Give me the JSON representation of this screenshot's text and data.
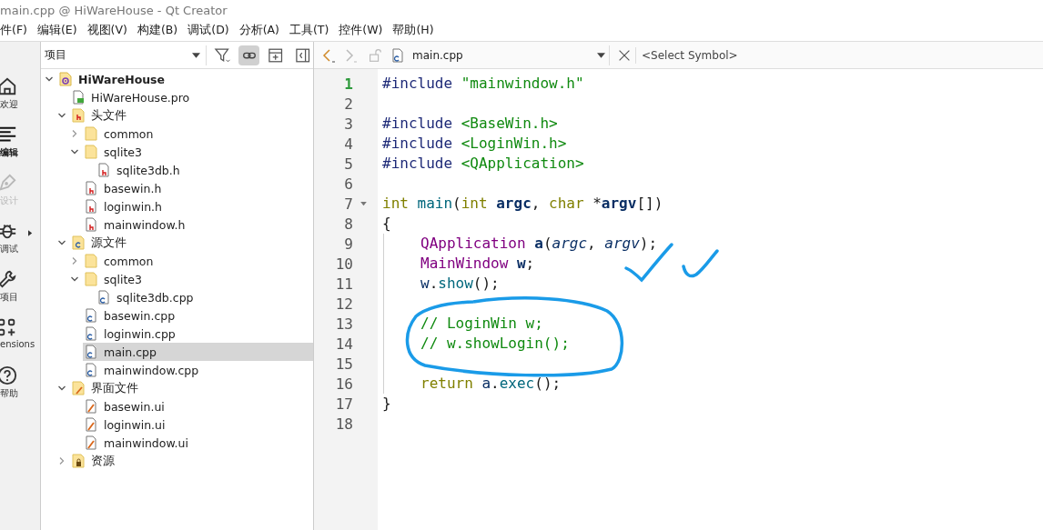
{
  "window": {
    "title": "main.cpp @ HiWareHouse - Qt Creator"
  },
  "menu_bar": [
    "件(F)",
    "编辑(E)",
    "视图(V)",
    "构建(B)",
    "调试(D)",
    "分析(A)",
    "工具(T)",
    "控件(W)",
    "帮助(H)"
  ],
  "mode_bar": [
    {
      "label": "欢迎",
      "kind": "welcome",
      "selected": false,
      "disabled": false
    },
    {
      "label": "编辑",
      "kind": "edit",
      "selected": true,
      "disabled": false
    },
    {
      "label": "设计",
      "kind": "design",
      "selected": false,
      "disabled": true
    },
    {
      "label": "调试",
      "kind": "debug",
      "selected": false,
      "disabled": false
    },
    {
      "label": "项目",
      "kind": "projects",
      "selected": false,
      "disabled": false
    },
    {
      "label": "ensions",
      "kind": "extensions",
      "selected": false,
      "disabled": false
    },
    {
      "label": "帮助",
      "kind": "help",
      "selected": false,
      "disabled": false
    }
  ],
  "project_panel": {
    "view_selector": "项目",
    "sync_with_editor": true,
    "tree": [
      {
        "label": "HiWareHouse",
        "kind": "project",
        "expanded": true,
        "selected": false,
        "children": [
          {
            "label": "HiWareHouse.pro",
            "kind": "pro",
            "selected": false
          },
          {
            "label": "头文件",
            "kind": "folder-h",
            "expanded": true,
            "selected": false,
            "children": [
              {
                "label": "common",
                "kind": "folder",
                "expanded": false,
                "selected": false
              },
              {
                "label": "sqlite3",
                "kind": "folder",
                "expanded": true,
                "selected": false,
                "children": [
                  {
                    "label": "sqlite3db.h",
                    "kind": "h",
                    "selected": false
                  }
                ]
              },
              {
                "label": "basewin.h",
                "kind": "h",
                "selected": false
              },
              {
                "label": "loginwin.h",
                "kind": "h",
                "selected": false
              },
              {
                "label": "mainwindow.h",
                "kind": "h",
                "selected": false
              }
            ]
          },
          {
            "label": "源文件",
            "kind": "folder-cpp",
            "expanded": true,
            "selected": false,
            "children": [
              {
                "label": "common",
                "kind": "folder",
                "expanded": false,
                "selected": false
              },
              {
                "label": "sqlite3",
                "kind": "folder",
                "expanded": true,
                "selected": false,
                "children": [
                  {
                    "label": "sqlite3db.cpp",
                    "kind": "cpp",
                    "selected": false
                  }
                ]
              },
              {
                "label": "basewin.cpp",
                "kind": "cpp",
                "selected": false
              },
              {
                "label": "loginwin.cpp",
                "kind": "cpp",
                "selected": false
              },
              {
                "label": "main.cpp",
                "kind": "cpp",
                "selected": true
              },
              {
                "label": "mainwindow.cpp",
                "kind": "cpp",
                "selected": false
              }
            ]
          },
          {
            "label": "界面文件",
            "kind": "folder-ui",
            "expanded": true,
            "selected": false,
            "children": [
              {
                "label": "basewin.ui",
                "kind": "ui",
                "selected": false
              },
              {
                "label": "loginwin.ui",
                "kind": "ui",
                "selected": false
              },
              {
                "label": "mainwindow.ui",
                "kind": "ui",
                "selected": false
              }
            ]
          },
          {
            "label": "资源",
            "kind": "folder-res",
            "expanded": false,
            "selected": false
          }
        ]
      }
    ]
  },
  "editor": {
    "file": "main.cpp",
    "symbol": "<Select Symbol>",
    "back_disabled": false,
    "forward_disabled": true,
    "lines": [
      {
        "number": "1",
        "current": true,
        "foldable": false,
        "indented": false,
        "tokens": [
          {
            "text": "#include ",
            "kind": "preproc"
          },
          {
            "text": "\"mainwindow.h\"",
            "kind": "string"
          }
        ]
      },
      {
        "number": "2",
        "current": false,
        "foldable": false,
        "indented": false
      },
      {
        "number": "3",
        "current": false,
        "foldable": false,
        "indented": false,
        "tokens": [
          {
            "text": "#include ",
            "kind": "preproc"
          },
          {
            "text": "<BaseWin.h>",
            "kind": "string"
          }
        ]
      },
      {
        "number": "4",
        "current": false,
        "foldable": false,
        "indented": false,
        "tokens": [
          {
            "text": "#include ",
            "kind": "preproc"
          },
          {
            "text": "<LoginWin.h>",
            "kind": "string"
          }
        ]
      },
      {
        "number": "5",
        "current": false,
        "foldable": false,
        "indented": false,
        "tokens": [
          {
            "text": "#include ",
            "kind": "preproc"
          },
          {
            "text": "<QApplication>",
            "kind": "string"
          }
        ]
      },
      {
        "number": "6",
        "current": false,
        "foldable": false,
        "indented": false
      },
      {
        "number": "7",
        "current": false,
        "foldable": true,
        "indented": false,
        "tokens": [
          {
            "text": "int ",
            "kind": "keyword"
          },
          {
            "text": "main",
            "kind": "function"
          },
          {
            "text": "(",
            "kind": "plain"
          },
          {
            "text": "int ",
            "kind": "keyword"
          },
          {
            "text": "argc",
            "kind": "local"
          },
          {
            "text": ", ",
            "kind": "plain"
          },
          {
            "text": "char ",
            "kind": "keyword"
          },
          {
            "text": "*",
            "kind": "plain"
          },
          {
            "text": "argv",
            "kind": "local"
          },
          {
            "text": "[])",
            "kind": "plain"
          }
        ]
      },
      {
        "number": "8",
        "current": false,
        "foldable": false,
        "indented": false,
        "tokens": [
          {
            "text": "{",
            "kind": "plain"
          }
        ]
      },
      {
        "number": "9",
        "current": false,
        "foldable": false,
        "indented": true,
        "tokens": [
          {
            "text": "QApplication ",
            "kind": "type"
          },
          {
            "text": "a",
            "kind": "local"
          },
          {
            "text": "(",
            "kind": "plain"
          },
          {
            "text": "argc",
            "kind": "param"
          },
          {
            "text": ", ",
            "kind": "plain"
          },
          {
            "text": "argv",
            "kind": "param"
          },
          {
            "text": ");",
            "kind": "plain"
          }
        ]
      },
      {
        "number": "10",
        "current": false,
        "foldable": false,
        "indented": true,
        "tokens": [
          {
            "text": "MainWindow ",
            "kind": "type"
          },
          {
            "text": "w",
            "kind": "local"
          },
          {
            "text": ";",
            "kind": "plain"
          }
        ]
      },
      {
        "number": "11",
        "current": false,
        "foldable": false,
        "indented": true,
        "tokens": [
          {
            "text": "w",
            "kind": "variable"
          },
          {
            "text": ".",
            "kind": "plain"
          },
          {
            "text": "show",
            "kind": "function"
          },
          {
            "text": "();",
            "kind": "plain"
          }
        ]
      },
      {
        "number": "12",
        "current": false,
        "foldable": false,
        "indented": true
      },
      {
        "number": "13",
        "current": false,
        "foldable": false,
        "indented": true,
        "tokens": [
          {
            "text": "// LoginWin w;",
            "kind": "comment"
          }
        ]
      },
      {
        "number": "14",
        "current": false,
        "foldable": false,
        "indented": true,
        "tokens": [
          {
            "text": "// w.showLogin();",
            "kind": "comment"
          }
        ]
      },
      {
        "number": "15",
        "current": false,
        "foldable": false,
        "indented": true
      },
      {
        "number": "16",
        "current": false,
        "foldable": false,
        "indented": true,
        "tokens": [
          {
            "text": "return ",
            "kind": "keyword"
          },
          {
            "text": "a",
            "kind": "variable"
          },
          {
            "text": ".",
            "kind": "plain"
          },
          {
            "text": "exec",
            "kind": "function"
          },
          {
            "text": "();",
            "kind": "plain"
          }
        ]
      },
      {
        "number": "17",
        "current": false,
        "foldable": false,
        "indented": false,
        "tokens": [
          {
            "text": "}",
            "kind": "plain"
          }
        ]
      },
      {
        "number": "18",
        "current": false,
        "foldable": false,
        "indented": false
      }
    ]
  }
}
